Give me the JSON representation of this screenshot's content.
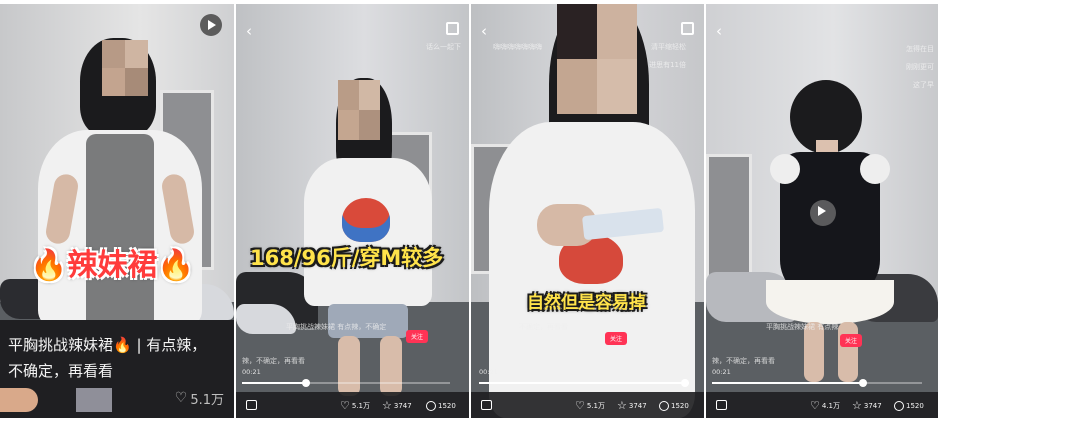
{
  "panels": {
    "one": {
      "caption": "🔥辣妹裙🔥",
      "title": "平胸挑战辣妹裙🔥 | 有点辣，不确定，再看看",
      "likes": "5.1万",
      "icons": {
        "play": "play-circle-icon",
        "like": "heart-outline-icon"
      }
    },
    "two": {
      "back": "‹",
      "caption": "168/96斤/穿M较多",
      "top_right_line": "话么一起下",
      "overlay_line_1": "平胸挑战辣妹裙 有点辣，不确定",
      "overlay_line_2": "辣，不确定，再看看",
      "follow": "关注",
      "time": "00:21",
      "likes": "5.1万",
      "stars": "3747",
      "comments": "1520"
    },
    "three": {
      "back": "‹",
      "caption": "自然但是容易掉",
      "top_line_1": "嗨嗨嗨嗨嗨嗨嗨",
      "top_line_2": "清平缩轻松",
      "top_line_3": "进思有11倍",
      "overlay_line_1": "不确定，再看看",
      "follow": "关注",
      "time": "00:21",
      "likes": "5.1万",
      "stars": "3747",
      "comments": "1520"
    },
    "four": {
      "back": "‹",
      "top_line_1": "怎得在目",
      "top_line_2": "刚刚更可",
      "top_line_3": "这了早",
      "overlay_line_1": "平胸挑战辣妹裙 有点辣",
      "overlay_line_2": "辣，不确定，再看看",
      "follow": "关注",
      "time": "00:21",
      "likes": "4.1万",
      "stars": "3747",
      "comments": "1520"
    }
  },
  "colors": {
    "caption_yellow": "#ffe34a",
    "caption_red": "#ff3b3b",
    "follow_pink": "#ff3355",
    "card_bg": "#1f1f22"
  }
}
